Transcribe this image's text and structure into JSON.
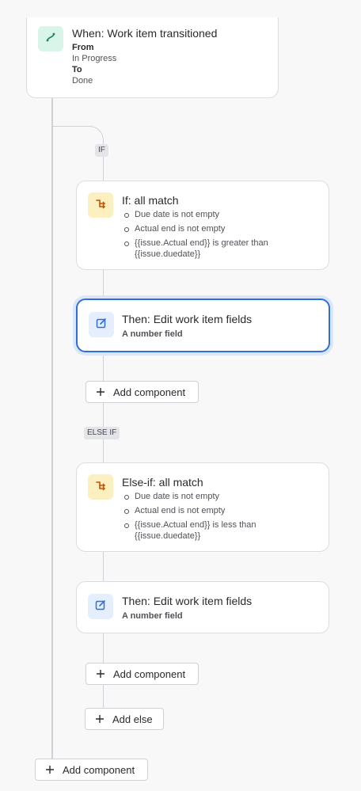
{
  "trigger": {
    "title": "When: Work item transitioned",
    "from_label": "From",
    "from_value": "In Progress",
    "to_label": "To",
    "to_value": "Done"
  },
  "branches": {
    "if_tag": "IF",
    "if_title": "If: all match",
    "if_conditions": [
      "Due date is not empty",
      "Actual end is not empty",
      "{{issue.Actual end}} is greater than {{issue.duedate}}"
    ],
    "then1_title": "Then: Edit work item fields",
    "then1_sub": "A number field",
    "add_component_1": "Add component",
    "else_if_tag": "ELSE IF",
    "else_if_title": "Else-if: all match",
    "else_if_conditions": [
      "Due date is not empty",
      "Actual end is not empty",
      "{{issue.Actual end}} is less than {{issue.duedate}}"
    ],
    "then2_title": "Then: Edit work item fields",
    "then2_sub": "A number field",
    "add_component_2": "Add component",
    "add_else": "Add else"
  },
  "footer": {
    "add_component": "Add component"
  },
  "icons": {
    "trigger": "branch-route-icon",
    "condition": "condition-branch-icon",
    "action": "edit-pencil-icon",
    "add": "plus-icon"
  },
  "colors": {
    "selected_border": "#2f6fdb",
    "trigger_icon": "#1f845a",
    "condition_icon": "#c25100",
    "action_icon": "#2f6fdb"
  }
}
